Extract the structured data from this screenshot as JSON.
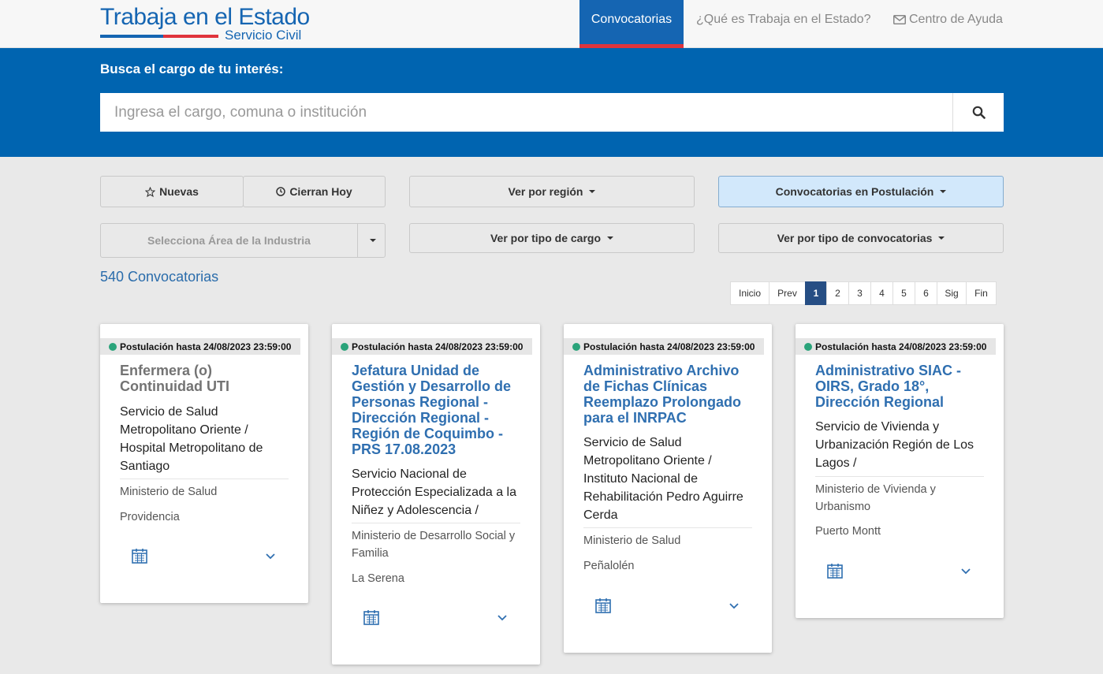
{
  "header": {
    "logo_title": "Trabaja en el Estado",
    "logo_subtitle": "Servicio Civil",
    "nav": {
      "convocatorias": "Convocatorias",
      "que_es": "¿Qué es Trabaja en el Estado?",
      "ayuda": "Centro de Ayuda"
    }
  },
  "search": {
    "label": "Busca el cargo de tu interés:",
    "placeholder": "Ingresa el cargo, comuna o institución"
  },
  "filters": {
    "nuevas": "Nuevas",
    "cierran_hoy": "Cierran Hoy",
    "region": "Ver por región",
    "postulacion": "Convocatorias en Postulación",
    "area": "Selecciona Área de la Industria",
    "tipo_cargo": "Ver por tipo de cargo",
    "tipo_convocatoria": "Ver por tipo de convocatorias"
  },
  "results": {
    "count": "540 Convocatorias"
  },
  "pagination": {
    "inicio": "Inicio",
    "prev": "Prev",
    "pages": [
      "1",
      "2",
      "3",
      "4",
      "5",
      "6"
    ],
    "current": "1",
    "sig": "Sig",
    "fin": "Fin"
  },
  "cards": [
    {
      "deadline": "Postulación hasta 24/08/2023 23:59:00",
      "title": "Enfermera (o) Continuidad UTI",
      "organization": "Servicio de Salud Metropolitano Oriente / Hospital Metropolitano de Santiago",
      "ministry": "Ministerio de Salud",
      "location": "Providencia"
    },
    {
      "deadline": "Postulación hasta 24/08/2023 23:59:00",
      "title": "Jefatura Unidad de Gestión y Desarrollo de Personas Regional - Dirección Regional - Región de Coquimbo - PRS 17.08.2023",
      "organization": "Servicio Nacional de Protección Especializada a la Niñez y Adolescencia /",
      "ministry": "Ministerio de Desarrollo Social y Familia",
      "location": "La Serena"
    },
    {
      "deadline": "Postulación hasta 24/08/2023 23:59:00",
      "title": "Administrativo Archivo de Fichas Clínicas Reemplazo Prolongado para el INRPAC",
      "organization": "Servicio de Salud Metropolitano Oriente / Instituto Nacional de Rehabilitación Pedro Aguirre Cerda",
      "ministry": "Ministerio de Salud",
      "location": "Peñalolén"
    },
    {
      "deadline": "Postulación hasta 24/08/2023 23:59:00",
      "title": "Administrativo SIAC - OIRS, Grado 18°, Dirección Regional",
      "organization": "Servicio de Vivienda y Urbanización Región de Los Lagos /",
      "ministry": "Ministerio de Vivienda y Urbanismo",
      "location": "Puerto Montt"
    }
  ],
  "colors": {
    "brand_blue": "#0064b0",
    "accent_red": "#e0343c",
    "status_green": "#2aa37a",
    "link_blue": "#2f6fb0"
  }
}
